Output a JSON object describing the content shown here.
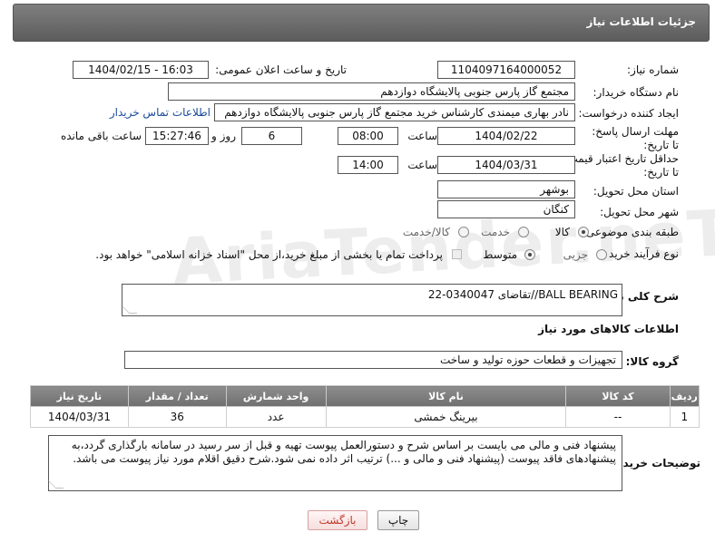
{
  "header": {
    "title": "جزئیات اطلاعات نیاز"
  },
  "fields": {
    "need_number_label": "شماره نیاز:",
    "need_number": "1104097164000052",
    "announce_label": "تاریخ و ساعت اعلان عمومی:",
    "announce_value": "1404/02/15 - 16:03",
    "buyer_org_label": "نام دستگاه خریدار:",
    "buyer_org": "مجتمع گاز پارس جنوبی  پالایشگاه دوازدهم",
    "creator_label": "ایجاد کننده درخواست:",
    "creator": "نادر بهاری میمندی کارشناس خرید مجتمع گاز پارس جنوبی  پالایشگاه دوازدهم",
    "contact_link": "اطلاعات تماس خریدار",
    "deadline_label": "مهلت ارسال پاسخ: تا تاریخ:",
    "deadline_date": "1404/02/22",
    "time_label": "ساعت",
    "deadline_time": "08:00",
    "days_value": "6",
    "days_label": "روز و",
    "remaining_time": "15:27:46",
    "remaining_label": "ساعت باقی مانده",
    "validity_label": "حداقل تاریخ اعتبار قیمت: تا تاریخ:",
    "validity_date": "1404/03/31",
    "validity_time": "14:00",
    "province_label": "استان محل تحویل:",
    "province": "بوشهر",
    "city_label": "شهر محل تحویل:",
    "city": "کنگان",
    "category_label": "طبقه بندی موضوعی:",
    "category_options": [
      "کالا",
      "خدمت",
      "کالا/خدمت"
    ],
    "process_label": "نوع فرآیند خرید :",
    "process_options": [
      "جزیی",
      "متوسط"
    ],
    "payment_note": "پرداخت تمام یا بخشی از مبلغ خرید،از محل \"اسناد خزانه اسلامی\" خواهد بود.",
    "description_label": "شرح کلی نیاز:",
    "description": "BALL BEARING//تقاضای 0340047-22",
    "goods_info_title": "اطلاعات کالاهای مورد نیاز",
    "goods_group_label": "گروه کالا:",
    "goods_group": "تجهیزات و قطعات حوزه تولید و ساخت"
  },
  "table": {
    "headers": [
      "ردیف",
      "کد کالا",
      "نام کالا",
      "واحد شمارش",
      "تعداد / مقدار",
      "تاریخ نیاز"
    ],
    "rows": [
      [
        "1",
        "--",
        "بیرینگ خمشی",
        "عدد",
        "36",
        "1404/03/31"
      ]
    ]
  },
  "buyer_notes_label": "توضیحات خریدار:",
  "buyer_notes": "پیشنهاد فنی و مالی می بایست بر اساس شرح و دستورالعمل پیوست تهیه و قبل از سر رسید در سامانه بارگذاری گردد،به پیشنهادهای فاقد پیوست (پیشنهاد فنی و مالی و ...) ترتیب اثر داده نمی شود.شرح دقیق اقلام مورد نیاز پیوست می باشد.",
  "buttons": {
    "print": "چاپ",
    "back": "بازگشت"
  },
  "watermark": "AriaTender.neT",
  "colors": {
    "header_bg": "#6b6b6b",
    "back_button_text": "#c0392b",
    "link": "#1a4a9a"
  }
}
